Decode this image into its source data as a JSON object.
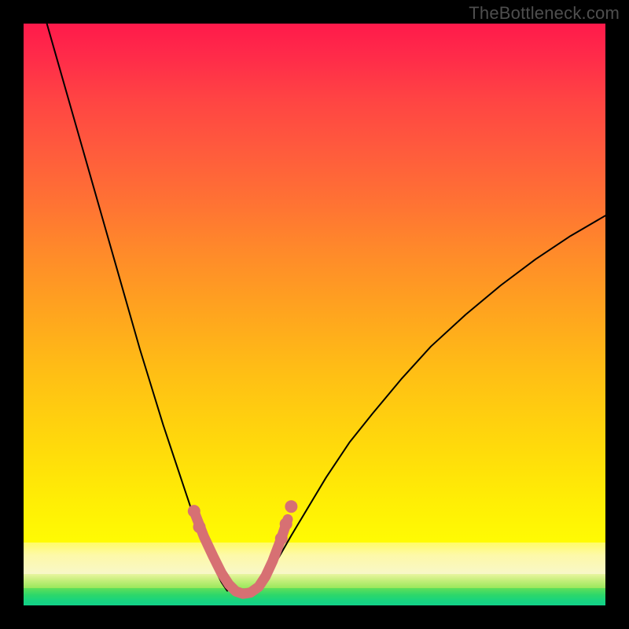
{
  "watermark": {
    "text": "TheBottleneck.com"
  },
  "colors": {
    "marker": "#d77073",
    "curve": "#000000",
    "frame": "#000000"
  },
  "chart_data": {
    "type": "line",
    "title": "",
    "xlabel": "",
    "ylabel": "",
    "xlim": [
      0,
      100
    ],
    "ylim": [
      0,
      100
    ],
    "grid": false,
    "legend": false,
    "background_bands": [
      {
        "name": "red-yellow-gradient",
        "y_range": [
          11,
          100
        ]
      },
      {
        "name": "pale-band",
        "y_range": [
          5.4,
          11
        ]
      },
      {
        "name": "yellow-green-band",
        "y_range": [
          3.0,
          5.4
        ]
      },
      {
        "name": "green-band",
        "y_range": [
          0,
          3.0
        ]
      }
    ],
    "series": [
      {
        "name": "left-arm",
        "x": [
          4,
          6,
          8,
          10,
          12,
          14,
          16,
          18,
          20,
          22,
          24,
          26,
          28,
          29.5,
          31,
          32.5,
          34,
          35
        ],
        "y": [
          100,
          93,
          86,
          79,
          72,
          65,
          58,
          51,
          44,
          37.5,
          31,
          25,
          19,
          14.5,
          10.5,
          7,
          4,
          2.5
        ]
      },
      {
        "name": "right-arm",
        "x": [
          40,
          42,
          44,
          46,
          49,
          52,
          56,
          60,
          65,
          70,
          76,
          82,
          88,
          94,
          100
        ],
        "y": [
          2.5,
          5,
          8.5,
          12,
          17,
          22,
          28,
          33,
          39,
          44.5,
          50,
          55,
          59.5,
          63.5,
          67
        ]
      }
    ],
    "valley_outline": {
      "name": "valley-rose",
      "x": [
        29.3,
        31.0,
        32.6,
        34.0,
        35.3,
        36.5,
        37.7,
        39.0,
        40.4,
        41.6,
        42.8,
        44.1,
        45.4
      ],
      "y": [
        16.2,
        11.8,
        8.4,
        5.6,
        3.6,
        2.4,
        2.0,
        2.2,
        3.2,
        5.0,
        7.6,
        11.0,
        14.8
      ]
    },
    "markers": [
      {
        "x": 29.3,
        "y": 16.2
      },
      {
        "x": 30.2,
        "y": 13.5
      },
      {
        "x": 44.3,
        "y": 11.5
      },
      {
        "x": 45.1,
        "y": 14.0
      },
      {
        "x": 46.0,
        "y": 17.0
      }
    ]
  }
}
